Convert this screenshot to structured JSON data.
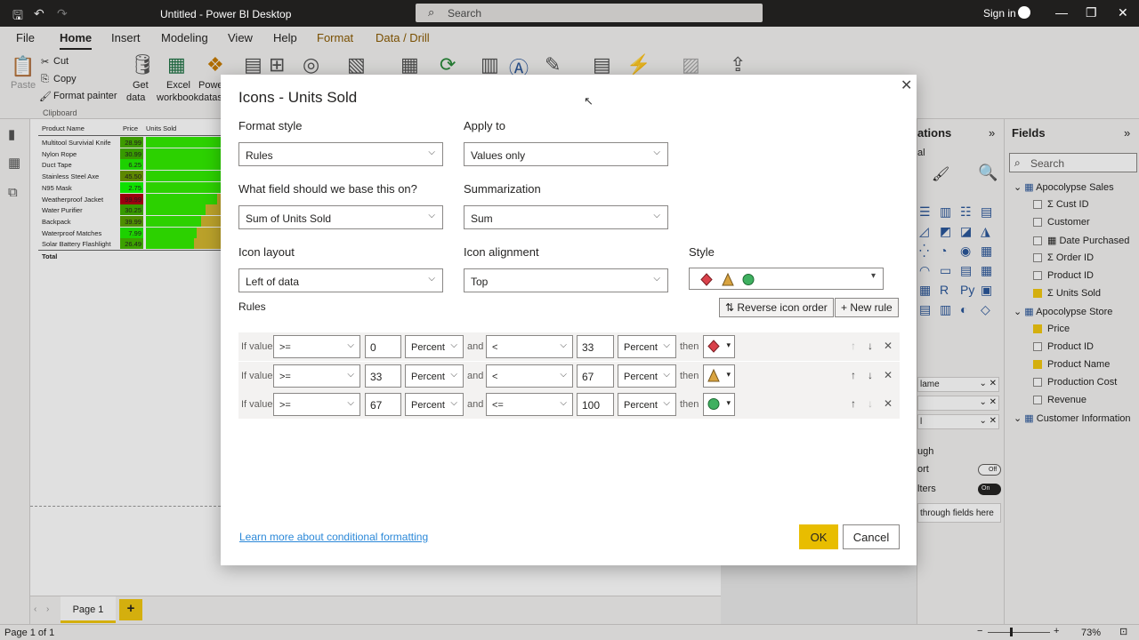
{
  "app": {
    "title": "Untitled - Power BI Desktop",
    "search_placeholder": "Search",
    "sign_in": "Sign in"
  },
  "menu": [
    "File",
    "Home",
    "Insert",
    "Modeling",
    "View",
    "Help",
    "Format",
    "Data / Drill"
  ],
  "ribbon": {
    "paste": "Paste",
    "cut": "Cut",
    "copy": "Copy",
    "format_painter": "Format painter",
    "clipboard_group": "Clipboard",
    "get_data": "Get",
    "get_data_2": "data",
    "excel": "Excel",
    "excel_2": "workbook",
    "power": "Power",
    "power_2": "datas"
  },
  "table": {
    "headers": [
      "Product Name",
      "Price",
      "Units Sold"
    ],
    "rows": [
      {
        "name": "Multitool Survivial Knife",
        "price": "28.99",
        "price_color": "#46b000",
        "units": 1.0
      },
      {
        "name": "Nylon Rope",
        "price": "30.99",
        "price_color": "#3fb000",
        "units": 1.0
      },
      {
        "name": "Duct Tape",
        "price": "6.25",
        "price_color": "#22ee00",
        "units": 1.0
      },
      {
        "name": "Stainless Steel Axe",
        "price": "45.50",
        "price_color": "#6a9a00",
        "units": 1.0
      },
      {
        "name": "N95 Mask",
        "price": "2.75",
        "price_color": "#11ff00",
        "units": 1.0
      },
      {
        "name": "Weatherproof Jacket",
        "price": "99.99",
        "price_color": "#b00010",
        "units": 0.95
      },
      {
        "name": "Water Purifier",
        "price": "30.25",
        "price_color": "#3fb000",
        "units": 0.8
      },
      {
        "name": "Backpack",
        "price": "39.99",
        "price_color": "#58a200",
        "units": 0.74
      },
      {
        "name": "Waterproof Matches",
        "price": "7.99",
        "price_color": "#22ee00",
        "units": 0.68
      },
      {
        "name": "Solar Battery Flashlight",
        "price": "26.49",
        "price_color": "#44b800",
        "units": 0.64
      }
    ],
    "total": "Total"
  },
  "viz_pane": {
    "title": "ations",
    "sub": "al"
  },
  "fields": {
    "title": "Fields",
    "search_placeholder": "Search",
    "items": [
      {
        "label": "Apocolypse Sales",
        "type": "table",
        "checked": false
      },
      {
        "label": "Cust ID",
        "type": "sigma",
        "checked": false
      },
      {
        "label": "Customer",
        "type": "field",
        "checked": false
      },
      {
        "label": "Date Purchased",
        "type": "date",
        "checked": false
      },
      {
        "label": "Order ID",
        "type": "sigma",
        "checked": false
      },
      {
        "label": "Product ID",
        "type": "field",
        "checked": false
      },
      {
        "label": "Units Sold",
        "type": "sigma",
        "checked": true
      },
      {
        "label": "Apocolypse Store",
        "type": "table",
        "checked": false
      },
      {
        "label": "Price",
        "type": "field",
        "checked": true
      },
      {
        "label": "Product ID",
        "type": "field",
        "checked": false
      },
      {
        "label": "Product Name",
        "type": "field",
        "checked": true
      },
      {
        "label": "Production Cost",
        "type": "field",
        "checked": false
      },
      {
        "label": "Revenue",
        "type": "field",
        "checked": false
      },
      {
        "label": "Customer Information",
        "type": "table",
        "checked": false
      }
    ]
  },
  "right_partial": {
    "name1": "lame",
    "name3": "l",
    "ugh": "ugh",
    "ort": "ort",
    "off": "Off",
    "lters": "lters",
    "on": "On",
    "drill": "through fields here"
  },
  "dialog": {
    "title": "Icons - Units Sold",
    "format_style_label": "Format style",
    "format_style_value": "Rules",
    "apply_to_label": "Apply to",
    "apply_to_value": "Values only",
    "base_field_label": "What field should we base this on?",
    "base_field_value": "Sum of Units Sold",
    "summarization_label": "Summarization",
    "summarization_value": "Sum",
    "icon_layout_label": "Icon layout",
    "icon_layout_value": "Left of data",
    "icon_alignment_label": "Icon alignment",
    "icon_alignment_value": "Top",
    "style_label": "Style",
    "rules_label": "Rules",
    "reverse_btn": "Reverse icon order",
    "new_rule_btn": "New rule",
    "rules": [
      {
        "if": "If value",
        "op1": ">=",
        "v1": "0",
        "u1": "Percent",
        "and": "and",
        "op2": "<",
        "v2": "33",
        "u2": "Percent",
        "then": "then",
        "icon": "red-diamond-icon"
      },
      {
        "if": "If value",
        "op1": ">=",
        "v1": "33",
        "u1": "Percent",
        "and": "and",
        "op2": "<",
        "v2": "67",
        "u2": "Percent",
        "then": "then",
        "icon": "yellow-triangle-icon"
      },
      {
        "if": "If value",
        "op1": ">=",
        "v1": "67",
        "u1": "Percent",
        "and": "and",
        "op2": "<=",
        "v2": "100",
        "u2": "Percent",
        "then": "then",
        "icon": "green-circle-icon"
      }
    ],
    "learn_more": "Learn more about conditional formatting",
    "ok": "OK",
    "cancel": "Cancel"
  },
  "pages": {
    "tab": "Page 1",
    "add": "+"
  },
  "status": {
    "page": "Page 1 of 1",
    "zoom": "73%"
  }
}
